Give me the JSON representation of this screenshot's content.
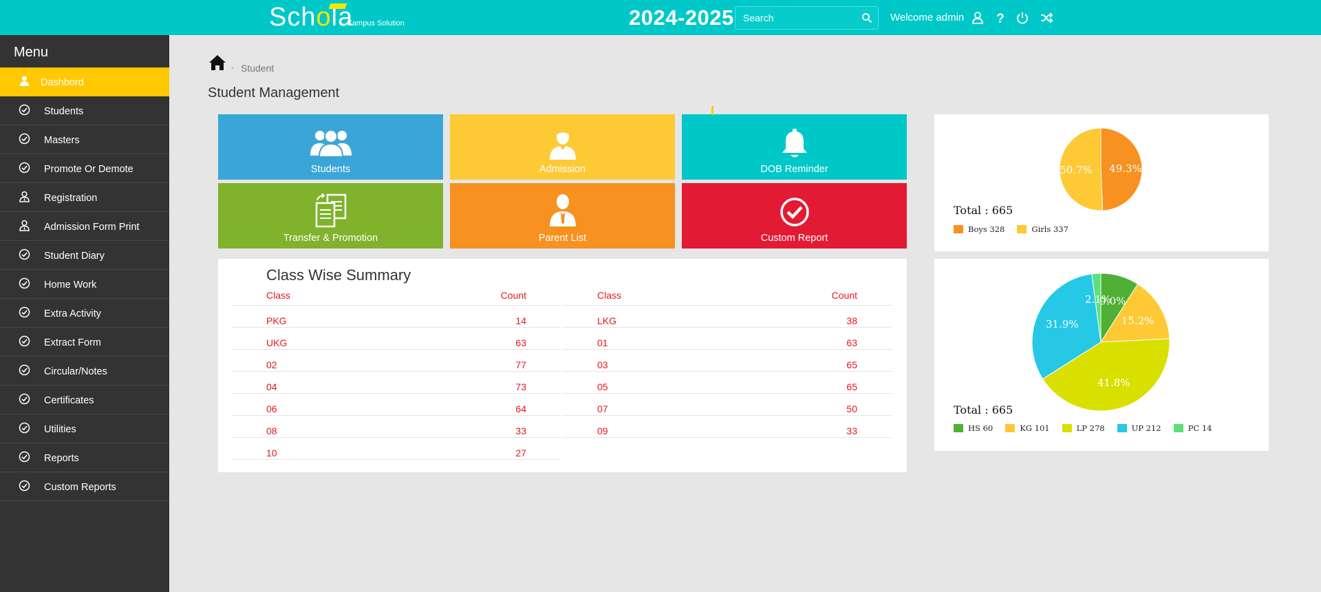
{
  "header": {
    "logo_text": "Schola",
    "logo_sub": "Campus Solution",
    "year": "2024-2025",
    "search_placeholder": "Search",
    "welcome": "Welcome admin"
  },
  "sidebar": {
    "title": "Menu",
    "items": [
      {
        "label": "Dashbord",
        "icon": "user-icon",
        "active": true
      },
      {
        "label": "Students",
        "icon": "check-circle-icon"
      },
      {
        "label": "Masters",
        "icon": "check-circle-icon"
      },
      {
        "label": "Promote Or Demote",
        "icon": "check-circle-icon"
      },
      {
        "label": "Registration",
        "icon": "user-tie-icon"
      },
      {
        "label": "Admission Form Print",
        "icon": "user-tie-icon"
      },
      {
        "label": "Student Diary",
        "icon": "check-circle-icon"
      },
      {
        "label": "Home Work",
        "icon": "check-circle-icon"
      },
      {
        "label": "Extra Activity",
        "icon": "check-circle-icon"
      },
      {
        "label": "Extract Form",
        "icon": "check-circle-icon"
      },
      {
        "label": "Circular/Notes",
        "icon": "check-circle-icon"
      },
      {
        "label": "Certificates",
        "icon": "check-circle-icon"
      },
      {
        "label": "Utilities",
        "icon": "check-circle-icon"
      },
      {
        "label": "Reports",
        "icon": "check-circle-icon"
      },
      {
        "label": "Custom Reports",
        "icon": "check-circle-icon"
      }
    ]
  },
  "breadcrumb": {
    "current": "Student"
  },
  "page_title": "Student Management",
  "tiles": [
    {
      "label": "Students",
      "color": "#3aa6d8",
      "icon": "users-icon"
    },
    {
      "label": "Admission",
      "color": "#fdc935",
      "icon": "admission-user-icon"
    },
    {
      "label": "DOB Reminder",
      "color": "#00c8c8",
      "icon": "bell-icon"
    },
    {
      "label": "Transfer & Promotion",
      "color": "#80b22c",
      "icon": "document-transfer-icon"
    },
    {
      "label": "Parent List",
      "color": "#f7911f",
      "icon": "parent-user-icon"
    },
    {
      "label": "Custom Report",
      "color": "#e31a34",
      "icon": "check-circle-icon"
    }
  ],
  "summary": {
    "title": "Class Wise Summary",
    "col_class": "Class",
    "col_count": "Count",
    "left_rows": [
      {
        "class": "PKG",
        "count": "14"
      },
      {
        "class": "UKG",
        "count": "63"
      },
      {
        "class": "02",
        "count": "77"
      },
      {
        "class": "04",
        "count": "73"
      },
      {
        "class": "06",
        "count": "64"
      },
      {
        "class": "08",
        "count": "33"
      },
      {
        "class": "10",
        "count": "27"
      }
    ],
    "right_rows": [
      {
        "class": "LKG",
        "count": "38"
      },
      {
        "class": "01",
        "count": "63"
      },
      {
        "class": "03",
        "count": "65"
      },
      {
        "class": "05",
        "count": "65"
      },
      {
        "class": "07",
        "count": "50"
      },
      {
        "class": "09",
        "count": "33"
      }
    ]
  },
  "gender_chart": {
    "total_label": "Total : 665",
    "legend": [
      {
        "label": "Boys 328",
        "color": "#f7911f"
      },
      {
        "label": "Girls 337",
        "color": "#fdc935"
      }
    ]
  },
  "section_chart": {
    "total_label": "Total : 665",
    "legend": [
      {
        "label": "HS 60",
        "color": "#4fb035"
      },
      {
        "label": "KG 101",
        "color": "#fdc935"
      },
      {
        "label": "LP 278",
        "color": "#d9e000"
      },
      {
        "label": "UP 212",
        "color": "#26c8e6"
      },
      {
        "label": "PC 14",
        "color": "#5de07a"
      }
    ]
  },
  "chart_data": [
    {
      "type": "pie",
      "title": "",
      "labels": [
        "Boys",
        "Girls"
      ],
      "values": [
        328,
        337
      ],
      "percent_labels": [
        "49.3%",
        "50.7%"
      ],
      "colors": [
        "#f7911f",
        "#fdc935"
      ],
      "total": 665
    },
    {
      "type": "pie",
      "title": "",
      "labels": [
        "HS",
        "KG",
        "LP",
        "UP",
        "PC"
      ],
      "values": [
        60,
        101,
        278,
        212,
        14
      ],
      "percent_labels": [
        "9.0%",
        "15.2%",
        "41.8%",
        "31.9%",
        "2.1%"
      ],
      "colors": [
        "#4fb035",
        "#fdc935",
        "#d9e000",
        "#26c8e6",
        "#5de07a"
      ],
      "total": 665
    }
  ]
}
